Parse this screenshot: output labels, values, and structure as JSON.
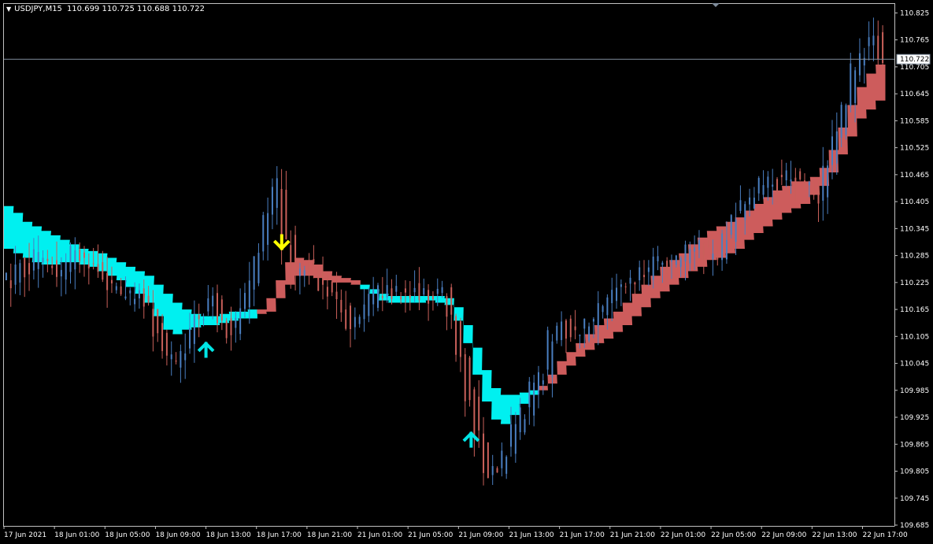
{
  "header": {
    "symbol": "USDJPY,M15",
    "open": "110.699",
    "high": "110.725",
    "low": "110.688",
    "close": "110.722"
  },
  "colors": {
    "background": "#000000",
    "axis": "#c0c0c0",
    "text": "#ffffff",
    "bull_candle": "#4a7fc1",
    "bear_candle": "#c9605a",
    "band_up": "#00f0f0",
    "band_down": "#cd5c5c",
    "arrow_up": "#00e5e5",
    "arrow_down": "#ffff00",
    "bid_line": "#7f8c9b"
  },
  "chart_data": {
    "type": "candlestick",
    "symbol": "USDJPY",
    "timeframe": "M15",
    "y_ticks": [
      "110.825",
      "110.765",
      "110.705",
      "110.645",
      "110.585",
      "110.525",
      "110.465",
      "110.405",
      "110.345",
      "110.285",
      "110.225",
      "110.165",
      "110.105",
      "110.045",
      "109.985",
      "109.925",
      "109.865",
      "109.805",
      "109.745",
      "109.685"
    ],
    "ylim": [
      109.685,
      110.845
    ],
    "x_ticks": [
      "17 Jun 2021",
      "18 Jun 01:00",
      "18 Jun 05:00",
      "18 Jun 09:00",
      "18 Jun 13:00",
      "18 Jun 17:00",
      "18 Jun 21:00",
      "21 Jun 01:00",
      "21 Jun 05:00",
      "21 Jun 09:00",
      "21 Jun 13:00",
      "21 Jun 17:00",
      "21 Jun 21:00",
      "22 Jun 01:00",
      "22 Jun 05:00",
      "22 Jun 09:00",
      "22 Jun 13:00",
      "22 Jun 17:00"
    ],
    "current_price": "110.722",
    "close_series": [
      110.23,
      110.27,
      110.25,
      110.28,
      110.26,
      110.24,
      110.26,
      110.3,
      110.28,
      110.27,
      110.24,
      110.22,
      110.2,
      110.19,
      110.2,
      110.18,
      110.12,
      110.06,
      110.05,
      110.08,
      110.14,
      110.16,
      110.2,
      110.14,
      110.12,
      110.16,
      110.22,
      110.3,
      110.38,
      110.44,
      110.32,
      110.24,
      110.27,
      110.25,
      110.22,
      110.2,
      110.17,
      110.14,
      110.15,
      110.18,
      110.2,
      110.21,
      110.2,
      110.19,
      110.21,
      110.2,
      110.19,
      110.2,
      110.14,
      110.06,
      109.98,
      109.88,
      109.8,
      109.8,
      109.85,
      109.9,
      109.94,
      109.99,
      110.02,
      110.1,
      110.13,
      110.12,
      110.11,
      110.14,
      110.16,
      110.18,
      110.21,
      110.22,
      110.23,
      110.24,
      110.27,
      110.28,
      110.26,
      110.28,
      110.3,
      110.32,
      110.29,
      110.28,
      110.33,
      110.37,
      110.4,
      110.42,
      110.44,
      110.45,
      110.44,
      110.46,
      110.45,
      110.43,
      110.42,
      110.48,
      110.56,
      110.62,
      110.7,
      110.74,
      110.78,
      110.72
    ],
    "band_segments": [
      {
        "trend": "up",
        "upper": [
          110.395,
          110.38,
          110.36,
          110.35,
          110.34,
          110.33,
          110.32,
          110.31,
          110.3,
          110.295,
          110.29,
          110.28,
          110.27,
          110.26,
          110.25,
          110.24,
          110.22,
          110.2,
          110.18,
          110.165,
          110.155,
          110.15,
          110.15,
          110.155,
          110.16,
          110.16,
          110.165
        ],
        "lower": [
          110.3,
          110.29,
          110.28,
          110.27,
          110.265,
          110.265,
          110.27,
          110.27,
          110.265,
          110.26,
          110.25,
          110.24,
          110.23,
          110.215,
          110.2,
          110.18,
          110.15,
          110.12,
          110.11,
          110.12,
          110.125,
          110.13,
          110.13,
          110.135,
          110.14,
          110.145,
          110.145
        ]
      },
      {
        "trend": "down",
        "upper": [
          110.165,
          110.19,
          110.23,
          110.27,
          110.28,
          110.275,
          110.265,
          110.25,
          110.24,
          110.235,
          110.23
        ],
        "lower": [
          110.155,
          110.16,
          110.19,
          110.22,
          110.24,
          110.24,
          110.235,
          110.23,
          110.225,
          110.225,
          110.22
        ]
      },
      {
        "trend": "up",
        "upper": [
          110.22,
          110.21,
          110.2,
          110.195,
          110.195,
          110.195,
          110.195,
          110.195,
          110.195,
          110.19,
          110.17,
          110.13,
          110.08,
          110.03,
          109.99,
          109.975,
          109.975,
          109.98,
          109.985
        ],
        "lower": [
          110.21,
          110.2,
          110.185,
          110.18,
          110.18,
          110.18,
          110.18,
          110.185,
          110.18,
          110.175,
          110.14,
          110.09,
          110.02,
          109.96,
          109.92,
          109.91,
          109.93,
          109.955,
          109.975
        ]
      },
      {
        "trend": "down",
        "upper": [
          109.995,
          110.02,
          110.05,
          110.07,
          110.09,
          110.11,
          110.13,
          110.145,
          110.16,
          110.18,
          110.2,
          110.22,
          110.24,
          110.26,
          110.275,
          110.29,
          110.31,
          110.325,
          110.34,
          110.35,
          110.36,
          110.37,
          110.385,
          110.4,
          110.415,
          110.43,
          110.44,
          110.45,
          110.45,
          110.46,
          110.48,
          110.52,
          110.57,
          110.62,
          110.66,
          110.69,
          110.71
        ],
        "lower": [
          109.985,
          110.0,
          110.02,
          110.04,
          110.06,
          110.075,
          110.09,
          110.1,
          110.115,
          110.13,
          110.15,
          110.17,
          110.19,
          110.205,
          110.22,
          110.235,
          110.25,
          110.26,
          110.275,
          110.28,
          110.29,
          110.3,
          110.32,
          110.335,
          110.35,
          110.365,
          110.38,
          110.39,
          110.4,
          110.42,
          110.44,
          110.47,
          110.51,
          110.55,
          110.59,
          110.61,
          110.63
        ]
      }
    ],
    "signals": [
      {
        "type": "up",
        "time": "18 Jun 13:00",
        "price": 110.11
      },
      {
        "type": "down",
        "time": "18 Jun 19:00",
        "price": 110.28
      },
      {
        "type": "up",
        "time": "21 Jun 10:00",
        "price": 109.91
      }
    ]
  }
}
